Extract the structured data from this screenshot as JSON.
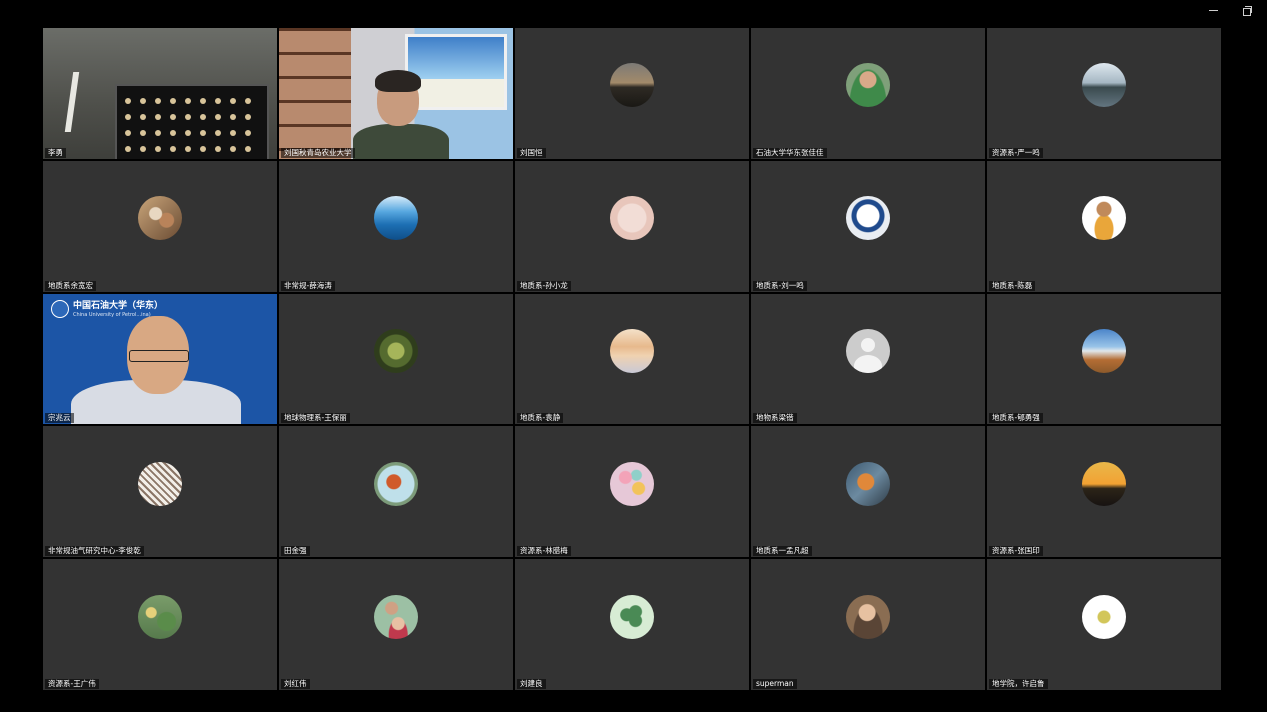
{
  "window": {
    "minimize_icon": "minimize-icon",
    "restore_icon": "restore-icon"
  },
  "participants": [
    {
      "name": "李勇",
      "type": "video",
      "scene": "room"
    },
    {
      "name": "刘国秋青岛农业大学",
      "type": "video",
      "scene": "study",
      "speaking": true
    },
    {
      "name": "刘国恒",
      "type": "avatar",
      "avatar": "sunset"
    },
    {
      "name": "石油大学华东张佳佳",
      "type": "avatar",
      "avatar": "person-green"
    },
    {
      "name": "资源系-严一鸣",
      "type": "avatar",
      "avatar": "lake"
    },
    {
      "name": "地质系余宽宏",
      "type": "avatar",
      "avatar": "crowd"
    },
    {
      "name": "非常规-薛海涛",
      "type": "avatar",
      "avatar": "pool"
    },
    {
      "name": "地质系-孙小龙",
      "type": "avatar",
      "avatar": "drawing"
    },
    {
      "name": "地质系-刘一鸣",
      "type": "avatar",
      "avatar": "robot"
    },
    {
      "name": "地质系-陈磊",
      "type": "avatar",
      "avatar": "monk"
    },
    {
      "name": "宗兆云",
      "type": "video",
      "scene": "blue",
      "banner": "中国石油大学（华东）",
      "banner_sub": "China University of Petrol...ina)"
    },
    {
      "name": "地球物理系-王保丽",
      "type": "avatar",
      "avatar": "forest"
    },
    {
      "name": "地质系-袁静",
      "type": "avatar",
      "avatar": "clouds"
    },
    {
      "name": "地物系梁锴",
      "type": "avatar",
      "avatar": "default"
    },
    {
      "name": "地质系-郇勇强",
      "type": "avatar",
      "avatar": "beach"
    },
    {
      "name": "非常规油气研究中心-李俊乾",
      "type": "avatar",
      "avatar": "pattern"
    },
    {
      "name": "田金强",
      "type": "avatar",
      "avatar": "fruit"
    },
    {
      "name": "资源系-林腊梅",
      "type": "avatar",
      "avatar": "flowers"
    },
    {
      "name": "地质系一孟凡超",
      "type": "avatar",
      "avatar": "koi"
    },
    {
      "name": "资源系-张国印",
      "type": "avatar",
      "avatar": "sunset2"
    },
    {
      "name": "资源系-王广伟",
      "type": "avatar",
      "avatar": "map"
    },
    {
      "name": "刘红伟",
      "type": "avatar",
      "avatar": "family"
    },
    {
      "name": "刘建良",
      "type": "avatar",
      "avatar": "clover"
    },
    {
      "name": "superman",
      "type": "avatar",
      "avatar": "baby"
    },
    {
      "name": "地学院，许启鲁",
      "type": "avatar",
      "avatar": "turtle"
    }
  ],
  "colors": {
    "tile_bg": "#333333",
    "active_border": "#2eb34a",
    "page_bg": "#000000"
  }
}
